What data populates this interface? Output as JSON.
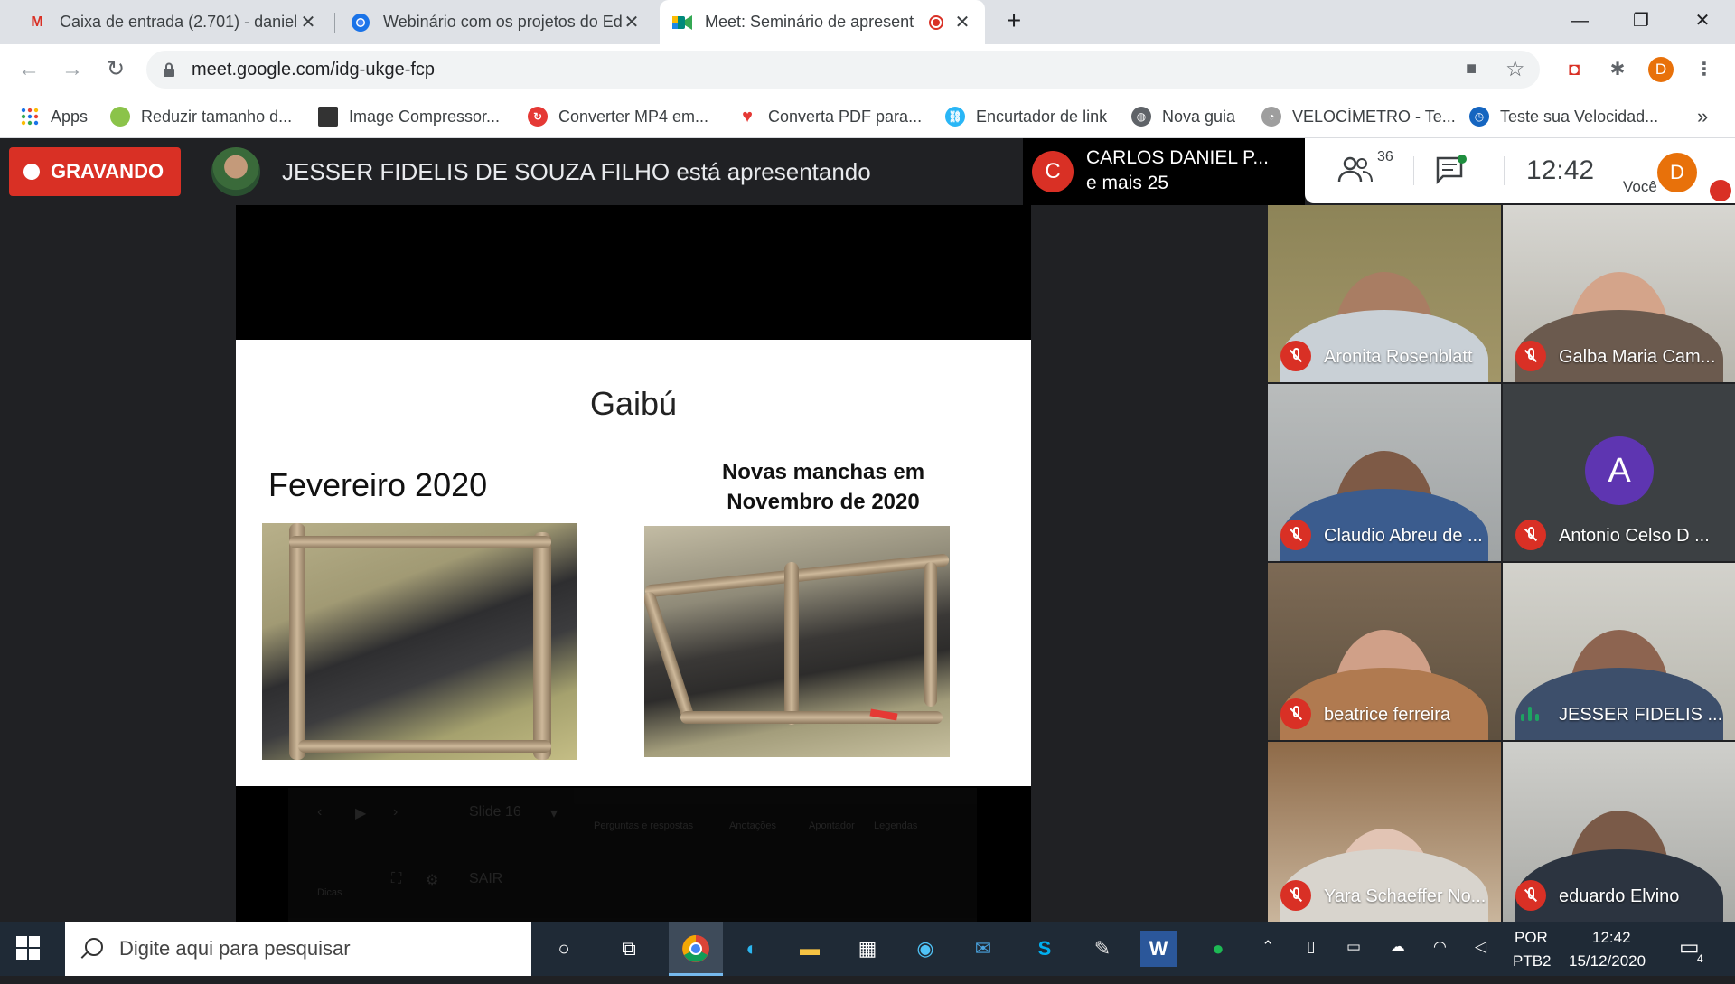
{
  "browser": {
    "tabs": [
      {
        "label": "Caixa de entrada (2.701) - daniel",
        "icon": "gmail-icon",
        "color": "#d93025"
      },
      {
        "label": "Webinário com os projetos do Ed",
        "icon": "chromium-icon",
        "color": "#1a73e8"
      },
      {
        "label": "Meet: Seminário de apresent",
        "icon": "meet-icon",
        "color": "#00897b"
      }
    ],
    "new_tab": "+",
    "url": "meet.google.com/idg-ukge-fcp",
    "profile_initial": "D",
    "bookmarks": [
      {
        "label": "Apps"
      },
      {
        "label": "Reduzir tamanho d..."
      },
      {
        "label": "Image Compressor..."
      },
      {
        "label": "Converter MP4 em..."
      },
      {
        "label": "Converta PDF para..."
      },
      {
        "label": "Encurtador de link"
      },
      {
        "label": "Nova guia"
      },
      {
        "label": "VELOCÍMETRO - Te..."
      },
      {
        "label": "Teste sua Velocidad..."
      }
    ],
    "more_bookmarks": "»"
  },
  "meet": {
    "recording_label": "GRAVANDO",
    "presenting_text": "JESSER FIDELIS DE SOUZA FILHO está apresentando",
    "caller": {
      "initial": "C",
      "name": "CARLOS DANIEL P...",
      "more": "e mais 25"
    },
    "participant_count": "36",
    "time": "12:42",
    "you_label": "Você",
    "you_initial": "D",
    "participants": [
      {
        "name": "Aronita Rosenblatt",
        "state": "muted"
      },
      {
        "name": "Galba Maria Cam...",
        "state": "muted"
      },
      {
        "name": "Claudio Abreu de ...",
        "state": "muted"
      },
      {
        "name": "Antonio Celso D ...",
        "state": "muted",
        "avatar": "A"
      },
      {
        "name": "beatrice ferreira",
        "state": "muted"
      },
      {
        "name": "JESSER FIDELIS ...",
        "state": "speaking"
      },
      {
        "name": "Yara Schaeffer No...",
        "state": "muted"
      },
      {
        "name": "eduardo Elvino",
        "state": "muted"
      }
    ]
  },
  "slide": {
    "title": "Gaibú",
    "left_caption": "Fevereiro 2020",
    "right_caption_line1": "Novas manchas em",
    "right_caption_line2": "Novembro de 2020",
    "controls": {
      "slide_label": "Slide 16",
      "qa": "Perguntas e respostas",
      "notes": "Anotações",
      "pointer": "Apontador",
      "captions": "Legendas",
      "tips": "Dicas",
      "exit": "SAIR"
    }
  },
  "taskbar": {
    "search_placeholder": "Digite aqui para pesquisar",
    "lang_top": "POR",
    "lang_bottom": "PTB2",
    "time": "12:42",
    "date": "15/12/2020",
    "notifications": "4"
  }
}
